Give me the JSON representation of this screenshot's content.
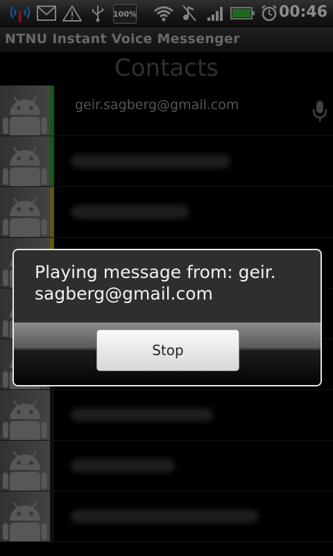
{
  "status_bar": {
    "time": "00:46",
    "battery": "100%",
    "icons": [
      "signal-broadcast-icon",
      "gmail-icon",
      "warning-icon",
      "usb-icon",
      "wifi-icon",
      "music-mute-icon",
      "cell-signal-icon",
      "battery-icon",
      "alarm-icon"
    ]
  },
  "app": {
    "title": "NTNU Instant Voice Messenger"
  },
  "screen": {
    "heading": "Contacts"
  },
  "contacts": [
    {
      "name": "geir.sagberg@gmail.com",
      "status_color": "#2e9b2e",
      "has_voice": true
    },
    {
      "name": "",
      "status_color": "#2e9b2e"
    },
    {
      "name": "",
      "status_color": "#a6a21a"
    },
    {
      "name": "",
      "status_color": "#a6a21a"
    },
    {
      "name": "",
      "status_color": "#1a1a1a"
    },
    {
      "name": "",
      "status_color": "#1a1a1a"
    },
    {
      "name": "",
      "status_color": "#1a1a1a"
    },
    {
      "name": "",
      "status_color": "#1a1a1a"
    },
    {
      "name": "",
      "status_color": "#1a1a1a"
    }
  ],
  "dialog": {
    "message": "Playing message from: geir. sagberg@gmail.com",
    "button": "Stop"
  }
}
